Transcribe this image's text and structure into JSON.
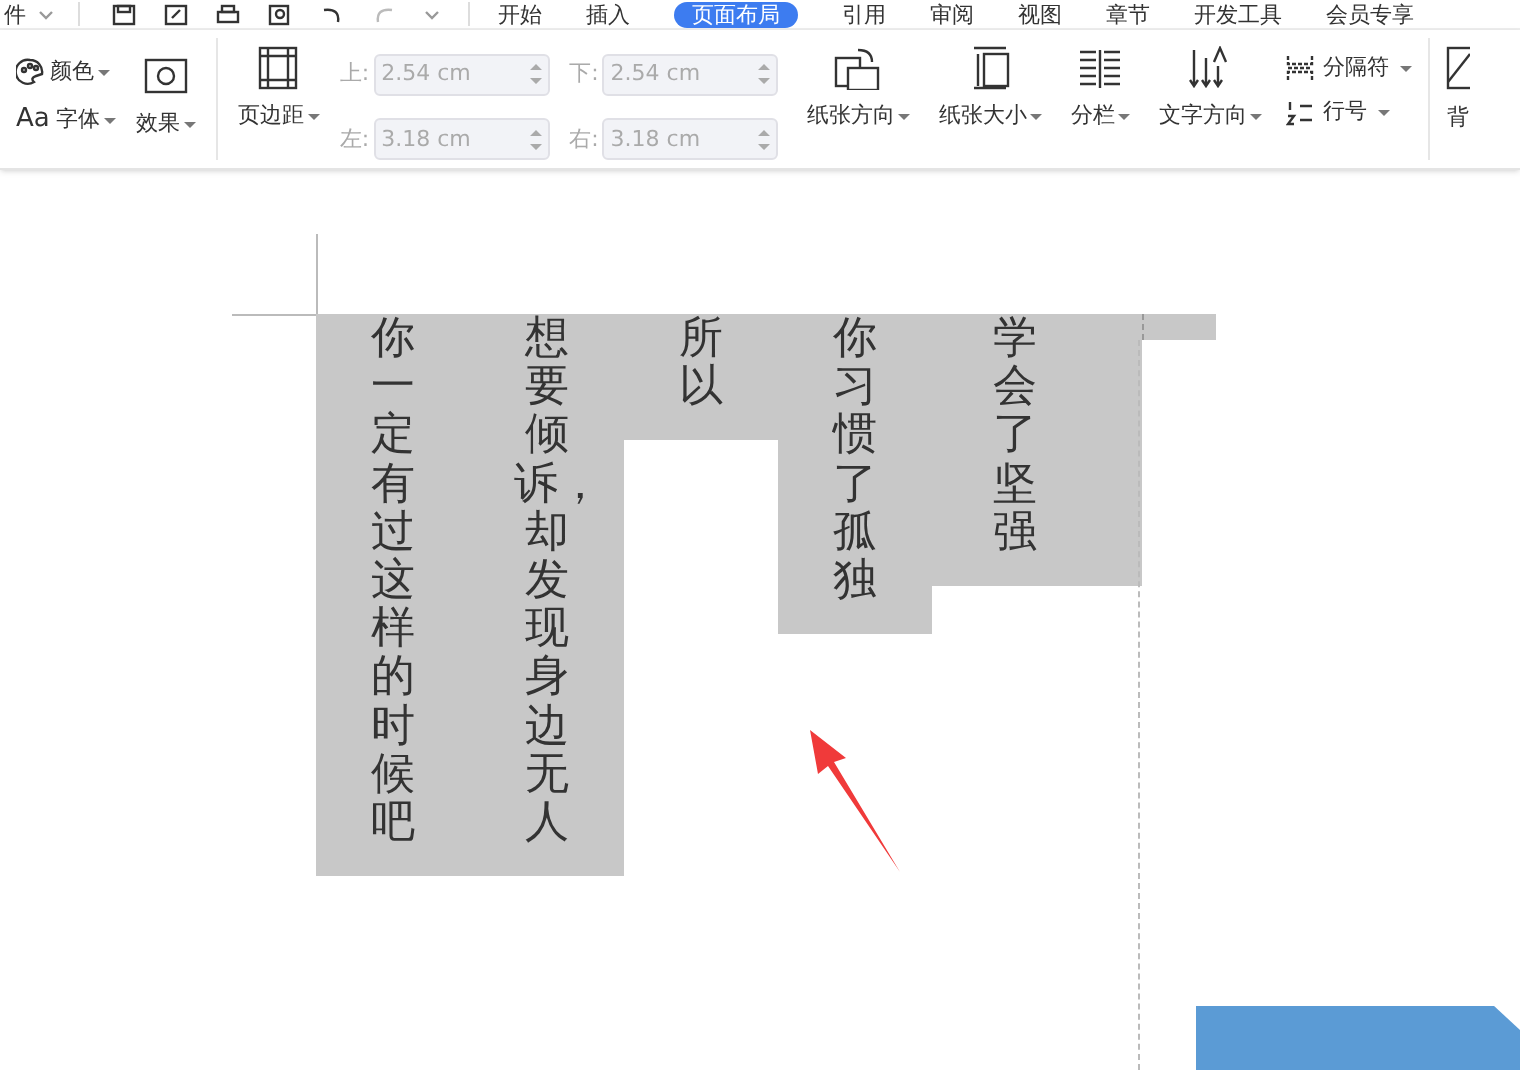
{
  "menu_fragment": "件",
  "tabs": [
    {
      "label": "开始",
      "selected": false
    },
    {
      "label": "插入",
      "selected": false
    },
    {
      "label": "页面布局",
      "selected": true
    },
    {
      "label": "引用",
      "selected": false
    },
    {
      "label": "审阅",
      "selected": false
    },
    {
      "label": "视图",
      "selected": false
    },
    {
      "label": "章节",
      "selected": false
    },
    {
      "label": "开发工具",
      "selected": false
    },
    {
      "label": "会员专享",
      "selected": false
    }
  ],
  "ribbon": {
    "theme_small": [
      {
        "label": "颜色"
      },
      {
        "label": "字体",
        "prefix": "Aa"
      }
    ],
    "effects": {
      "label": "效果"
    },
    "margins_button": {
      "label": "页边距"
    },
    "margin_fields": [
      {
        "label": "上:",
        "value": "2.54 cm",
        "disabled": true
      },
      {
        "label": "下:",
        "value": "2.54 cm",
        "disabled": true
      },
      {
        "label": "左:",
        "value": "3.18 cm",
        "disabled": true
      },
      {
        "label": "右:",
        "value": "3.18 cm",
        "disabled": true
      }
    ],
    "large_buttons": [
      {
        "kind": "orientation",
        "label": "纸张方向"
      },
      {
        "kind": "size",
        "label": "纸张大小"
      },
      {
        "kind": "columns",
        "label": "分栏"
      },
      {
        "kind": "direction",
        "label": "文字方向"
      }
    ],
    "small_buttons": [
      {
        "kind": "breaks",
        "label": "分隔符"
      },
      {
        "kind": "linenumbers",
        "label": "行号"
      }
    ],
    "cut_button": {
      "label": "背"
    }
  },
  "document": {
    "columns": [
      {
        "text": "你一定有过这样的时候吧"
      },
      {
        "text": "想要倾诉，却发现身边无人"
      },
      {
        "text": "所以"
      },
      {
        "text": "你习惯了孤独"
      },
      {
        "text": "学会了坚强"
      }
    ]
  }
}
